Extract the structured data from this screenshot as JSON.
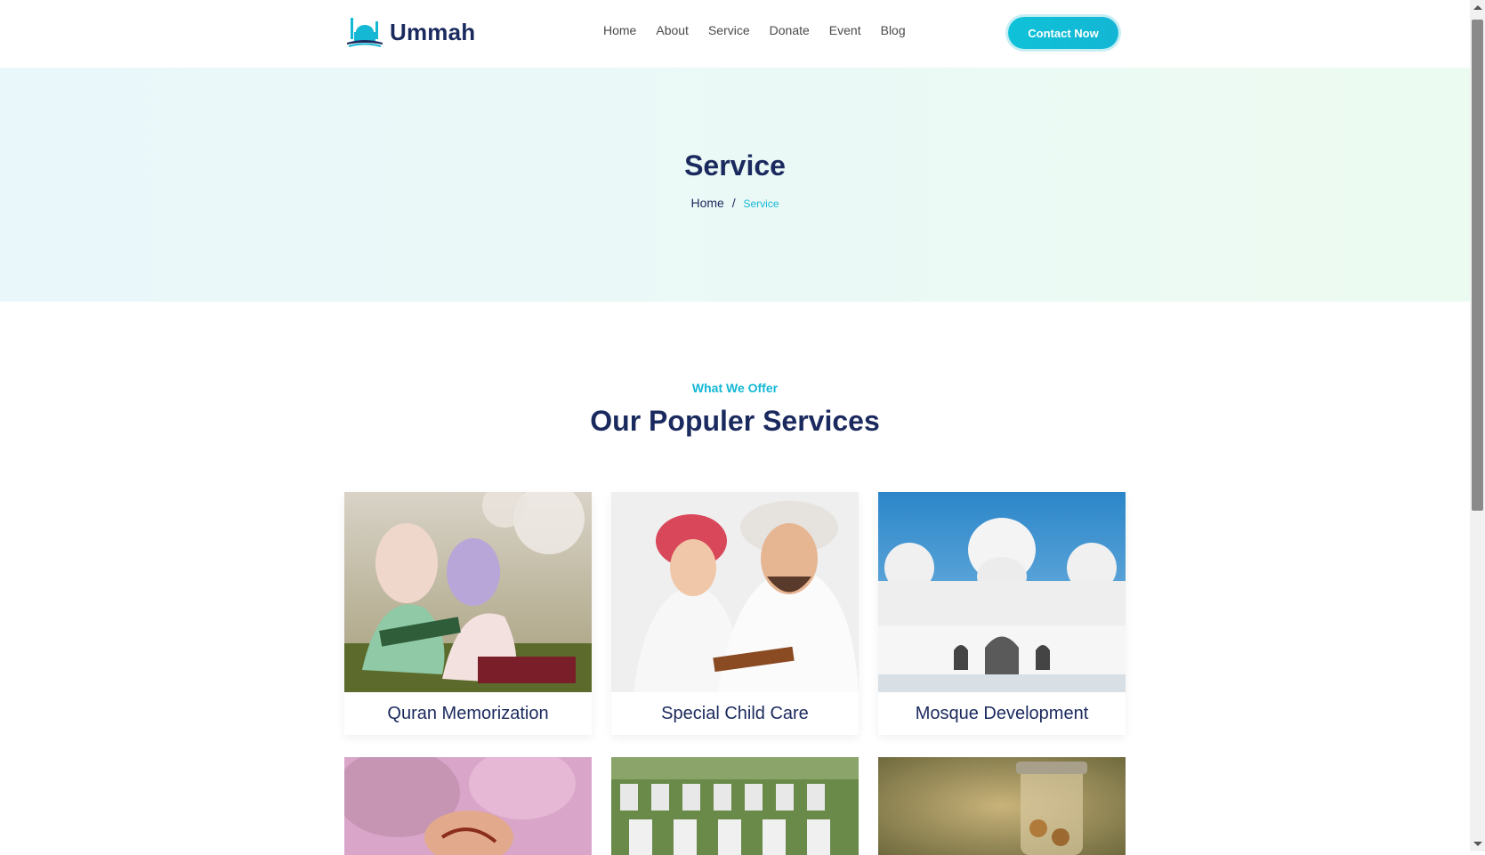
{
  "header": {
    "logo_text": "Ummah",
    "nav": [
      {
        "label": "Home"
      },
      {
        "label": "About"
      },
      {
        "label": "Service"
      },
      {
        "label": "Donate"
      },
      {
        "label": "Event"
      },
      {
        "label": "Blog"
      }
    ],
    "cta_label": "Contact Now"
  },
  "hero": {
    "title": "Service",
    "breadcrumb_home": "Home",
    "breadcrumb_sep": "/",
    "breadcrumb_current": "Service"
  },
  "section": {
    "eyebrow": "What We Offer",
    "title": "Our Populer Services"
  },
  "cards": [
    {
      "title": "Quran Memorization",
      "image": "women-reading-quran-photo"
    },
    {
      "title": "Special Child Care",
      "image": "father-son-reading-photo"
    },
    {
      "title": "Mosque Development",
      "image": "white-mosque-photo"
    }
  ],
  "bottom_cards": [
    {
      "image": "henna-hands-photo"
    },
    {
      "image": "graveyard-photo"
    },
    {
      "image": "coin-jar-photo"
    }
  ],
  "colors": {
    "navy": "#1b2a5e",
    "accent": "#14b8d5",
    "hero_bg_start": "#e9f7fb",
    "hero_bg_end": "#ecfbf1"
  }
}
